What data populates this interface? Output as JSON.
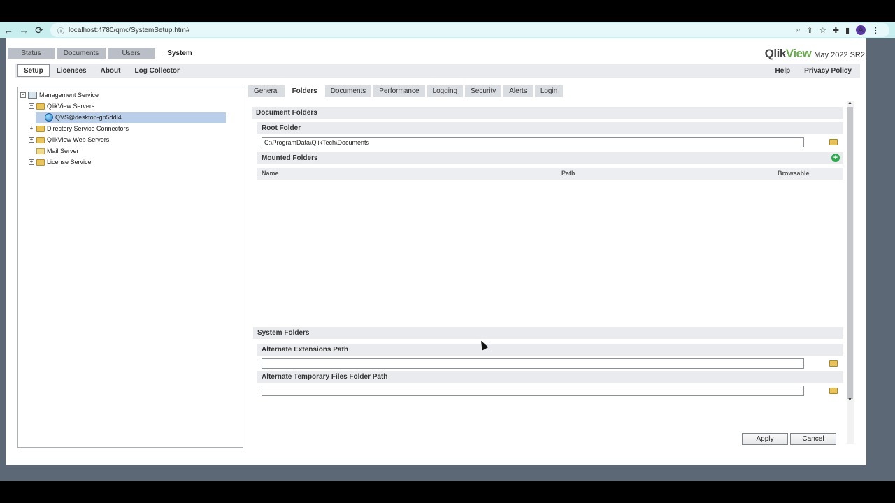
{
  "browser": {
    "url": "localhost:4780/qmc/SystemSetup.htm#",
    "avatar_letter": "A"
  },
  "main_tabs": [
    "Status",
    "Documents",
    "Users",
    "System"
  ],
  "logo": {
    "brand_q": "Qlik",
    "brand_v": "View",
    "version": "May 2022 SR2"
  },
  "subtabs": [
    "Setup",
    "Licenses",
    "About",
    "Log Collector"
  ],
  "subbar_right": [
    "Help",
    "Privacy Policy"
  ],
  "tree": {
    "root": "Management Service",
    "qv_servers": "QlikView Servers",
    "selected_server": "QVS@desktop-gn5ddl4",
    "dsc": "Directory Service Connectors",
    "web_servers": "QlikView Web Servers",
    "mail": "Mail Server",
    "license": "License Service"
  },
  "right_tabs": [
    "General",
    "Folders",
    "Documents",
    "Performance",
    "Logging",
    "Security",
    "Alerts",
    "Login"
  ],
  "document_folders": {
    "title": "Document Folders",
    "root_label": "Root Folder",
    "root_value": "C:\\ProgramData\\QlikTech\\Documents",
    "mounted_label": "Mounted Folders",
    "columns": [
      "Name",
      "Path",
      "Browsable"
    ]
  },
  "system_folders": {
    "title": "System Folders",
    "ext_label": "Alternate Extensions Path",
    "ext_value": "",
    "temp_label": "Alternate Temporary Files Folder Path",
    "temp_value": ""
  },
  "buttons": {
    "apply": "Apply",
    "cancel": "Cancel"
  },
  "icons": {
    "back": "←",
    "forward": "→",
    "reload": "⟳",
    "info": "ⓘ",
    "zoom": "⌕",
    "share": "⇪",
    "star": "☆",
    "ext": "✚",
    "side": "▮",
    "more": "⋮",
    "add": "+",
    "scroll_up": "▲",
    "scroll_down": "▼",
    "collapse": "−",
    "expand": "+"
  },
  "colors": {
    "accent_green": "#6aa84f",
    "selection": "#b9cfe9",
    "browser_bar": "#c9eef0"
  }
}
